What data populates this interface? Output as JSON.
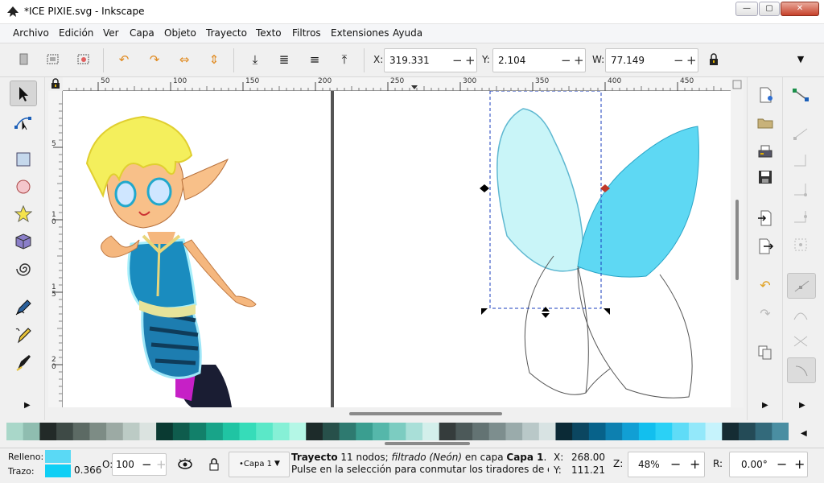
{
  "window": {
    "title": "*ICE PIXIE.svg - Inkscape",
    "controls": [
      "—",
      "▢",
      "✕"
    ]
  },
  "menu": [
    "Archivo",
    "Edición",
    "Ver",
    "Capa",
    "Objeto",
    "Trayecto",
    "Texto",
    "Filtros",
    "Extensiones",
    "Ayuda"
  ],
  "toolbar": {
    "x_label": "X:",
    "x_value": "319.331",
    "y_label": "Y:",
    "y_value": "2.104",
    "w_label": "W:",
    "w_value": "77.149",
    "minus": "−",
    "plus": "+"
  },
  "ruler": {
    "h_ticks": [
      "50",
      "100",
      "150",
      "200",
      "250",
      "300",
      "350",
      "400",
      "450"
    ],
    "v_ticks": [
      "5",
      "1 0",
      "1 5",
      "2 0"
    ]
  },
  "statusbar": {
    "fill_label": "Relleno:",
    "stroke_label": "Trazo:",
    "stroke_width": "0.366",
    "opacity_label": "O:",
    "opacity_value": "100",
    "layer_value": "•Capa 1",
    "msg_line1_bold": "Trayecto",
    "msg_line1_a": " 11 nodos; ",
    "msg_line1_italic": "filtrado (Neón)",
    "msg_line1_b": " en capa ",
    "msg_line1_layer": "Capa 1",
    "msg_line1_end": ".",
    "msg_line2": "Pulse en la selección para conmutar los tiradores de esc...",
    "cursor_x_label": "X:",
    "cursor_x": "268.00",
    "cursor_y_label": "Y:",
    "cursor_y": "111.21",
    "zoom_label": "Z:",
    "zoom_value": "48%",
    "rotate_label": "R:",
    "rotate_value": "0.00°"
  },
  "colors": {
    "fill": "#5ad9f5",
    "stroke": "#0fcff5",
    "wing_light": "#c9f5f8",
    "wing_dark": "#5ed8f3",
    "palette": [
      "#a9d7c9",
      "#8fbdb0",
      "#222a28",
      "#3e4a46",
      "#5c6a64",
      "#7d8c85",
      "#9caaa4",
      "#bccbc5",
      "#dbe3e0",
      "#0a3a32",
      "#0f5c4d",
      "#12806a",
      "#18a489",
      "#20c4a3",
      "#36dcb9",
      "#5be8c8",
      "#86f0d6",
      "#b4f7e6",
      "#1d2b2a",
      "#27504a",
      "#2e7a70",
      "#3a9e90",
      "#55b7aa",
      "#7cccc1",
      "#a9dfd8",
      "#d3efeb",
      "#353c3c",
      "#4c5959",
      "#637373",
      "#7d8e8e",
      "#9aabab",
      "#b9c8c8",
      "#d8e3e3",
      "#0b2a36",
      "#0b4660",
      "#07628a",
      "#0d80b0",
      "#119fd4",
      "#12bfee",
      "#2bd1f6",
      "#5fdcf7",
      "#93e8fa",
      "#c6f3fc",
      "#152c33",
      "#244b57",
      "#336a7b",
      "#4a8ea2"
    ]
  }
}
